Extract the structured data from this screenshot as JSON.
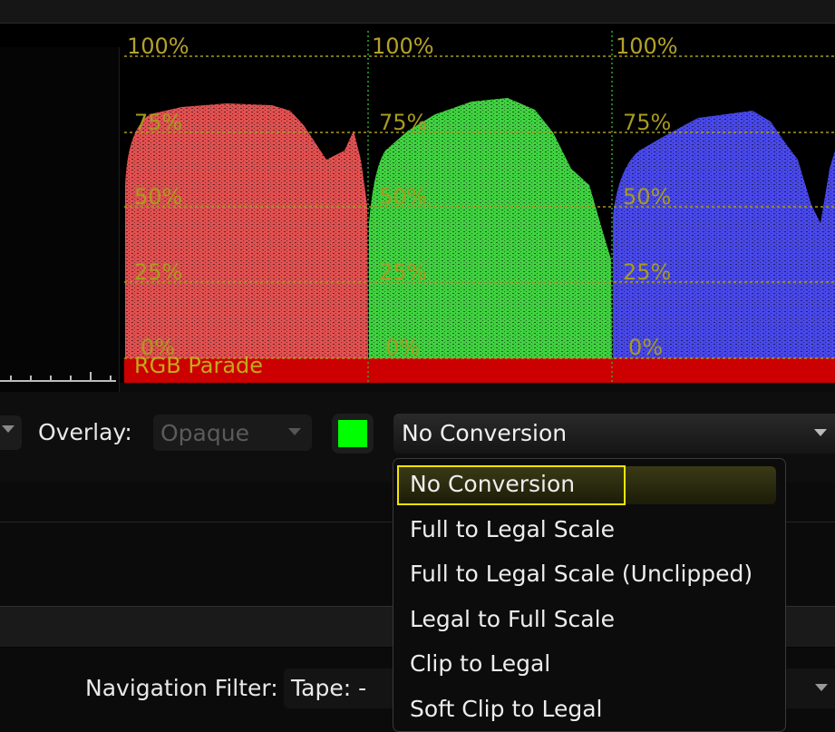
{
  "scope": {
    "title": "RGB Parade",
    "scale_value": "1000",
    "graticule": [
      "100%",
      "75%",
      "50%",
      "25%",
      "0%"
    ],
    "channel_colors": [
      "#e05050",
      "#40d040",
      "#4848e8"
    ]
  },
  "controls": {
    "overlay_label": "Overlay:",
    "overlay_value": "Opaque",
    "swatch_color": "#00ff00",
    "conversion_value": "No Conversion"
  },
  "dropdown": {
    "items": [
      "No Conversion",
      "Full to Legal Scale",
      "Full to Legal Scale (Unclipped)",
      "Legal to Full Scale",
      "Clip to Legal",
      "Soft Clip to Legal"
    ],
    "selected": "No Conversion"
  },
  "navigation": {
    "label": "Navigation Filter:",
    "value": "Tape: -"
  }
}
